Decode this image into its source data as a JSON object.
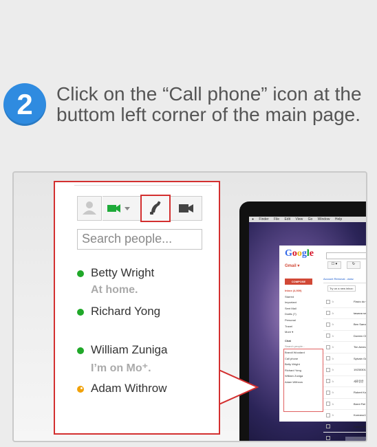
{
  "step": {
    "number": "2",
    "instruction": "Click on the “Call phone” icon at the buttom left corner of the main page."
  },
  "panel": {
    "search_placeholder": "Search people...",
    "contacts": [
      {
        "name": "Betty Wright",
        "status": "At home.",
        "presence": "online"
      },
      {
        "name": "Richard Yong",
        "status": "",
        "presence": "online"
      },
      {
        "name": "William Zuniga",
        "status": "I’m on Mo⁺.",
        "presence": "online"
      },
      {
        "name": "Adam Withrow",
        "status": "",
        "presence": "idle"
      }
    ],
    "icons": [
      "avatar-placeholder-icon",
      "video-call-icon",
      "call-phone-icon",
      "camera-icon"
    ]
  },
  "mini_screenshot": {
    "menubar": [
      "Finder",
      "File",
      "Edit",
      "View",
      "Go",
      "Window",
      "Help"
    ],
    "gmail_label": "Gmail ▾",
    "compose": "COMPOSE",
    "nav": [
      "Inbox (4,939)",
      "Starred",
      "Important",
      "Sent Mail",
      "Drafts (7)",
      "Personal",
      "Travel",
      "More ▾"
    ],
    "chat_items": [
      "Chat",
      "Search people...",
      "Brandi Woodard",
      "Call phone",
      "Betty Wright",
      "Richard Yong",
      "William Zuniga",
      "Adam Withrow"
    ],
    "header_link": "Account Removal - www.",
    "try_inbox": "Try on a new inbox:",
    "rows": [
      "Flavio do v",
      "tawana smi",
      "Ben Samano",
      "Doreen Chi",
      "Tim Ames",
      "Sylvain Gec",
      "1923030182",
      "세로운문",
      "Robert Kohl",
      "Brent Fiel",
      "Koreano11",
      "Fatema Bh",
      "Joruf Is"
    ]
  },
  "colors": {
    "badge": "#2f8be0",
    "highlight": "#d32f2f",
    "online": "#20a829",
    "idle": "#f1a20a"
  }
}
